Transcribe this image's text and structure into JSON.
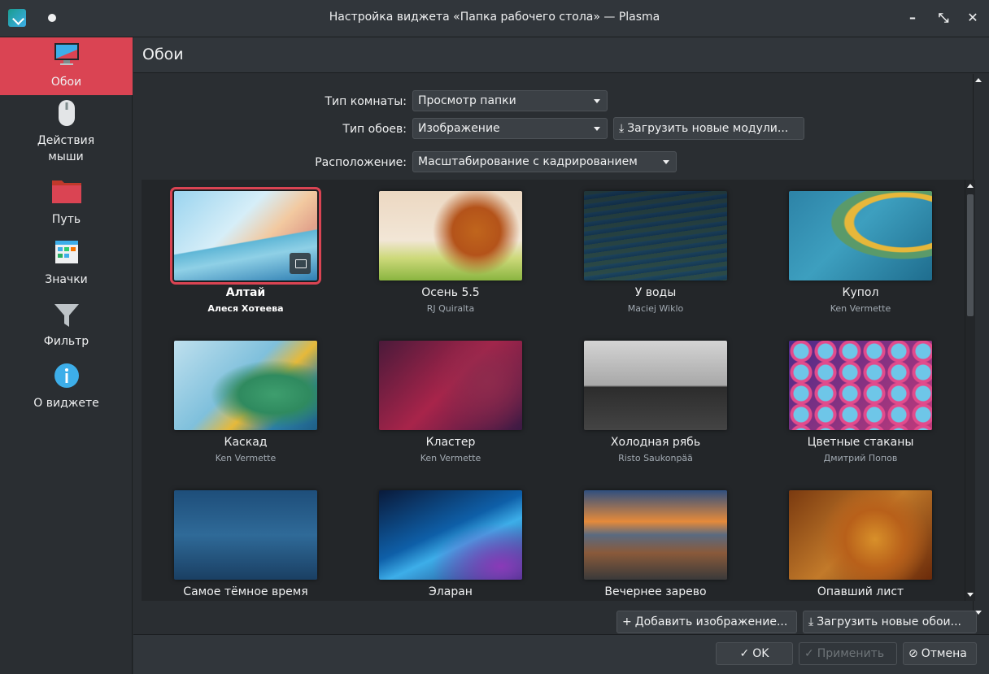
{
  "window": {
    "title": "Настройка виджета «Папка рабочего стола» — Plasma",
    "minimize_glyph": "–",
    "restore_glyph": "⤡",
    "close_glyph": "✕"
  },
  "sidebar": {
    "items": [
      {
        "label": "Обои",
        "icon": "monitor-icon",
        "active": true
      },
      {
        "label": "Действия мыши",
        "icon": "mouse-icon",
        "active": false
      },
      {
        "label": "Путь",
        "icon": "folder-icon",
        "active": false
      },
      {
        "label": "Значки",
        "icon": "icons-view-icon",
        "active": false
      },
      {
        "label": "Фильтр",
        "icon": "filter-icon",
        "active": false
      },
      {
        "label": "О виджете",
        "icon": "info-icon",
        "active": false
      }
    ]
  },
  "page": {
    "title": "Обои"
  },
  "form": {
    "layout_label": "Тип комнаты:",
    "layout_value": "Просмотр папки",
    "wallpaper_type_label": "Тип обоев:",
    "wallpaper_type_value": "Изображение",
    "get_plugins_label": "Загрузить новые модули...",
    "positioning_label": "Расположение:",
    "positioning_value": "Масштабирование с кадрированием"
  },
  "wallpapers": [
    {
      "name": "Алтай",
      "author": "Алеся Хотеева",
      "selected": true
    },
    {
      "name": "Осень 5.5",
      "author": "RJ Quiralta",
      "selected": false
    },
    {
      "name": "У воды",
      "author": "Maciej Wiklo",
      "selected": false
    },
    {
      "name": "Купол",
      "author": "Ken Vermette",
      "selected": false
    },
    {
      "name": "Каскад",
      "author": "Ken Vermette",
      "selected": false
    },
    {
      "name": "Кластер",
      "author": "Ken Vermette",
      "selected": false
    },
    {
      "name": "Холодная рябь",
      "author": "Risto Saukonpää",
      "selected": false
    },
    {
      "name": "Цветные стаканы",
      "author": "Дмитрий Попов",
      "selected": false
    },
    {
      "name": "Самое тёмное время",
      "author": "",
      "selected": false
    },
    {
      "name": "Эларан",
      "author": "",
      "selected": false
    },
    {
      "name": "Вечернее зарево",
      "author": "",
      "selected": false
    },
    {
      "name": "Опавший лист",
      "author": "",
      "selected": false
    }
  ],
  "actions": {
    "add_image": "Добавить изображение...",
    "get_wallpapers": "Загрузить новые обои..."
  },
  "dialog_buttons": {
    "ok": "OK",
    "apply": "Применить",
    "cancel": "Отмена"
  },
  "colors": {
    "accent": "#da4453",
    "window_bg": "#2a2e32",
    "header_bg": "#31363b"
  }
}
